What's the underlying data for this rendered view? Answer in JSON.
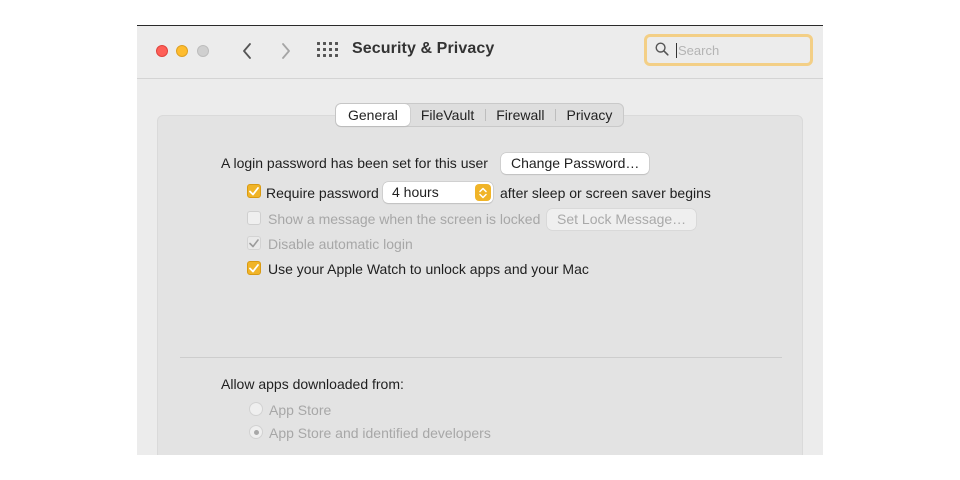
{
  "window": {
    "title": "Security & Privacy",
    "search": {
      "placeholder": "Search",
      "value": ""
    }
  },
  "colors": {
    "accent": "#f0b428",
    "close": "#fe5f57",
    "minimize": "#febc2e",
    "zoom": "#cfcfcf"
  },
  "icons": [
    "back-chevron-icon",
    "forward-chevron-icon",
    "grid-icon",
    "search-icon",
    "checkmark-icon",
    "stepper-icon"
  ],
  "tabs": [
    {
      "label": "General",
      "selected": true
    },
    {
      "label": "FileVault",
      "selected": false
    },
    {
      "label": "Firewall",
      "selected": false
    },
    {
      "label": "Privacy",
      "selected": false
    }
  ],
  "general": {
    "login_password_text": "A login password has been set for this user",
    "change_password_button": "Change Password…",
    "require_password": {
      "label": "Require password",
      "checked": true,
      "selected_option": "4 hours",
      "suffix": "after sleep or screen saver begins"
    },
    "show_message": {
      "label": "Show a message when the screen is locked",
      "checked": false,
      "enabled": false
    },
    "set_lock_message_button": "Set Lock Message…",
    "disable_auto_login": {
      "label": "Disable automatic login",
      "checked": true,
      "enabled": false
    },
    "apple_watch": {
      "label": "Use your Apple Watch to unlock apps and your Mac",
      "checked": true
    },
    "allow_apps": {
      "heading": "Allow apps downloaded from:",
      "options": [
        {
          "label": "App Store",
          "selected": false
        },
        {
          "label": "App Store and identified developers",
          "selected": true
        }
      ]
    }
  }
}
